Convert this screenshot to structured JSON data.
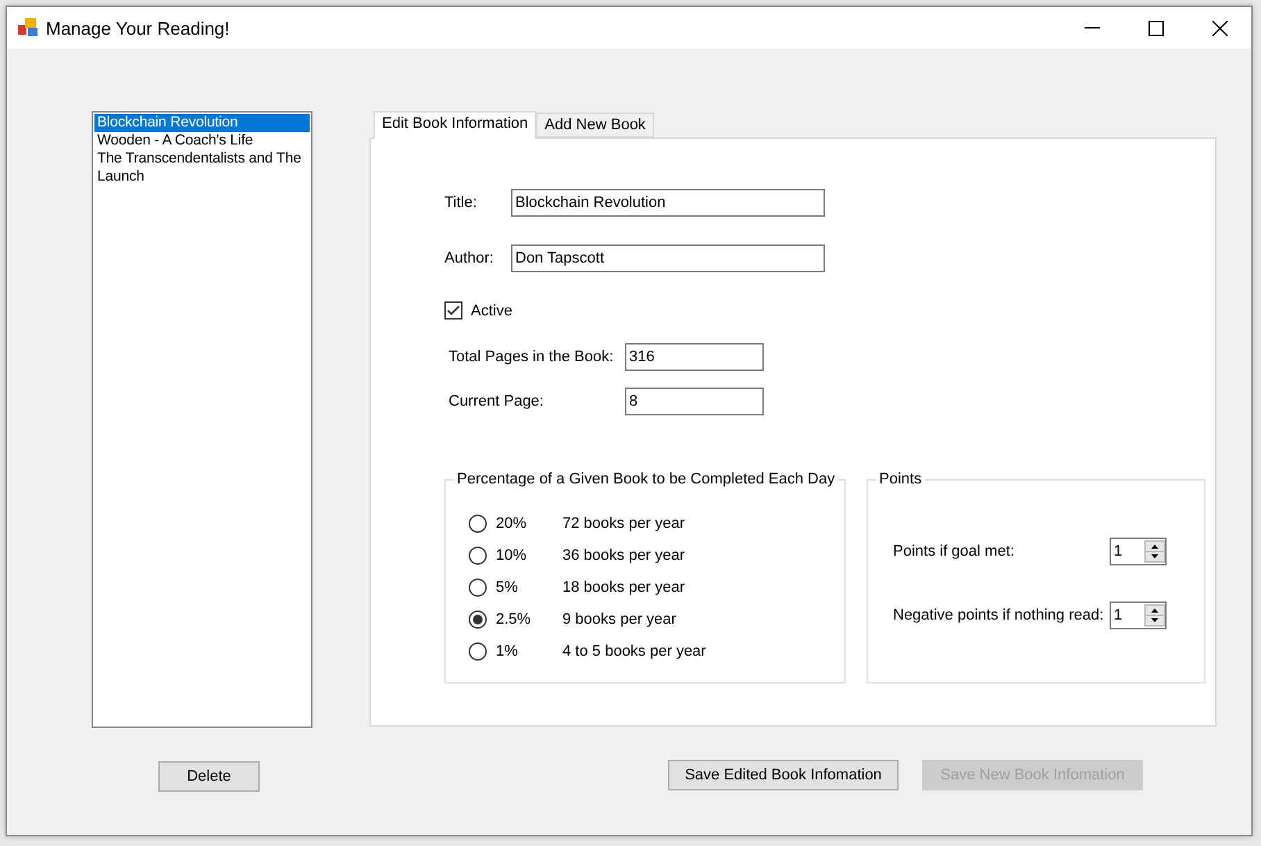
{
  "window": {
    "title": "Manage Your Reading!"
  },
  "books": [
    {
      "label": "Blockchain Revolution",
      "selected": true
    },
    {
      "label": "Wooden - A Coach's Life",
      "selected": false
    },
    {
      "label": "The Transcendentalists and The",
      "selected": false
    },
    {
      "label": "Launch",
      "selected": false
    }
  ],
  "delete_button": {
    "label": "Delete"
  },
  "tabs": [
    {
      "label": "Edit Book Information",
      "selected": true
    },
    {
      "label": "Add New Book",
      "selected": false
    }
  ],
  "form": {
    "title": {
      "label": "Title:",
      "value": "Blockchain Revolution"
    },
    "author": {
      "label": "Author:",
      "value": "Don Tapscott"
    },
    "active": {
      "label": "Active",
      "checked": true
    },
    "total_pages": {
      "label": "Total Pages in the Book:",
      "value": "316"
    },
    "current_page": {
      "label": "Current Page:",
      "value": "8"
    }
  },
  "goal_group": {
    "title": "Percentage of a Given Book to be Completed Each Day",
    "options": [
      {
        "percent": "20%",
        "books": "72 books per year",
        "selected": false
      },
      {
        "percent": "10%",
        "books": "36 books per year",
        "selected": false
      },
      {
        "percent": "5%",
        "books": "18 books per year",
        "selected": false
      },
      {
        "percent": "2.5%",
        "books": "9 books per year",
        "selected": true
      },
      {
        "percent": "1%",
        "books": "4 to 5 books per year",
        "selected": false
      }
    ]
  },
  "points_group": {
    "title": "Points",
    "fields": [
      {
        "label": "Points if goal met:",
        "value": "1"
      },
      {
        "label": "Negative points if nothing read:",
        "value": "1"
      }
    ]
  },
  "save_buttons": [
    {
      "label": "Save Edited Book Infomation",
      "disabled": false
    },
    {
      "label": "Save New Book Infomation",
      "disabled": true
    }
  ]
}
